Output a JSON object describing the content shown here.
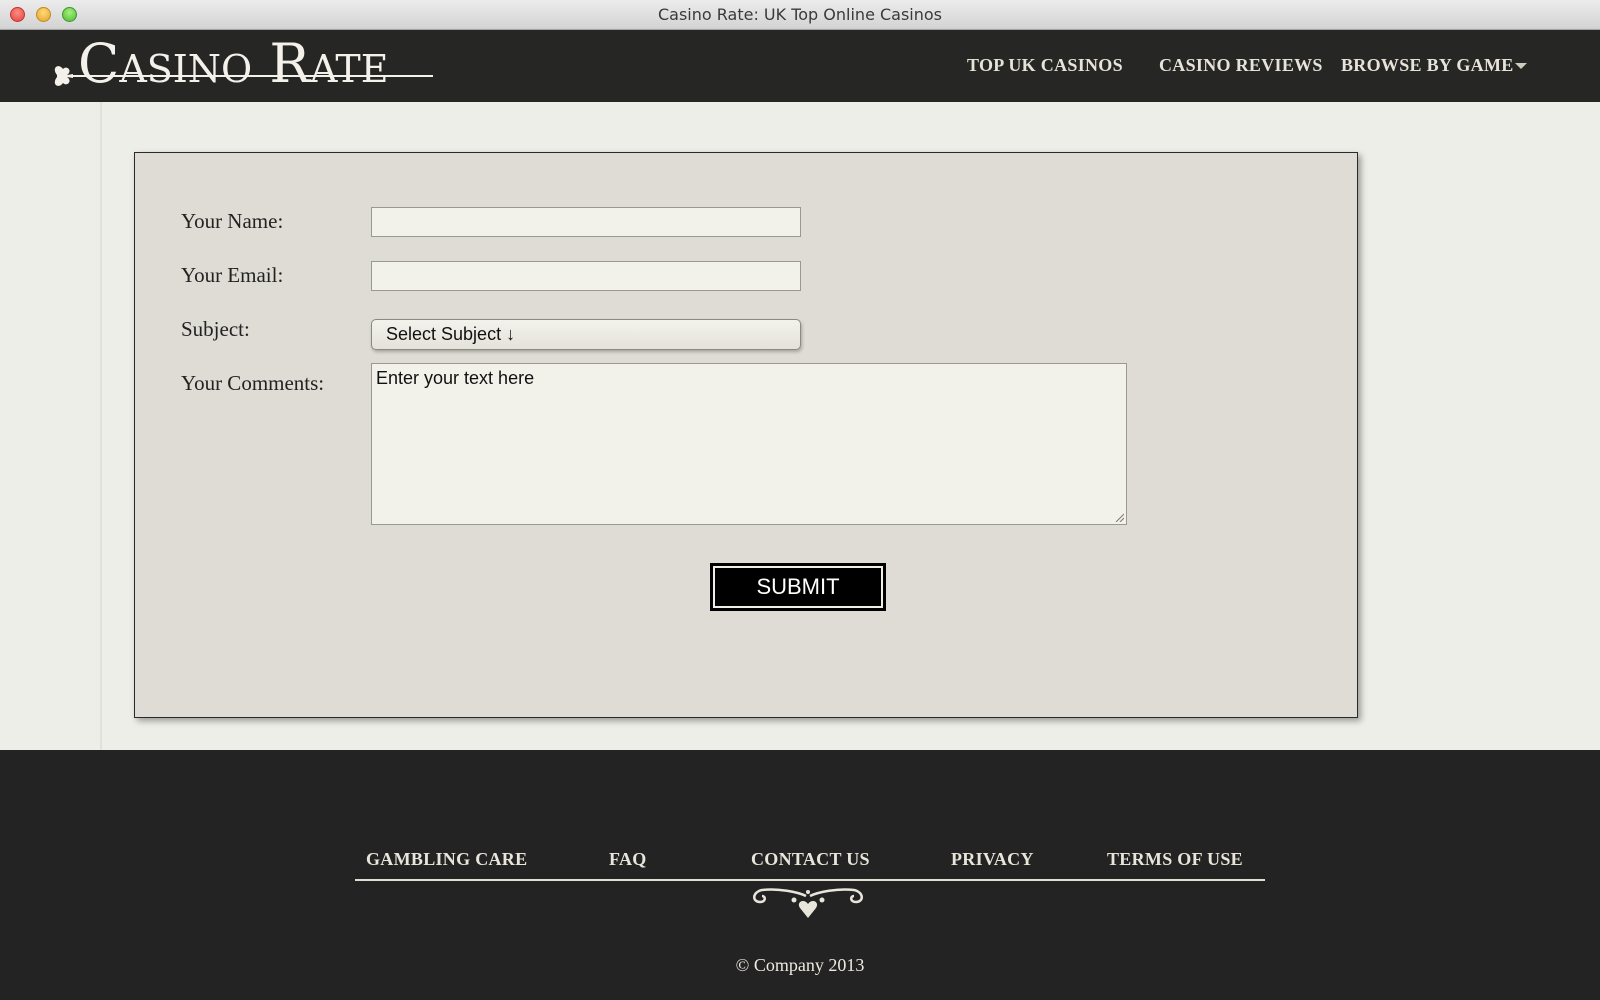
{
  "window": {
    "title": "Casino Rate: UK Top Online Casinos"
  },
  "header": {
    "logo_text": "Casino Rate",
    "nav": [
      {
        "label": "TOP UK CASINOS"
      },
      {
        "label": "CASINO REVIEWS"
      },
      {
        "label": "BROWSE BY GAME"
      }
    ]
  },
  "form": {
    "name_label": "Your Name:",
    "name_value": "",
    "email_label": "Your Email:",
    "email_value": "",
    "subject_label": "Subject:",
    "subject_selected": "Select Subject ↓",
    "comments_label": "Your Comments:",
    "comments_value": "Enter your text here",
    "submit_label": "SUBMIT"
  },
  "footer": {
    "links": [
      {
        "label": "GAMBLING CARE"
      },
      {
        "label": "FAQ"
      },
      {
        "label": "CONTACT US"
      },
      {
        "label": "PRIVACY"
      },
      {
        "label": "TERMS OF USE"
      }
    ],
    "copyright": "© Company 2013"
  },
  "colors": {
    "header_bg": "#262624",
    "footer_bg": "#232323",
    "panel_bg": "#dedcd4",
    "submit_bg": "#000000"
  }
}
